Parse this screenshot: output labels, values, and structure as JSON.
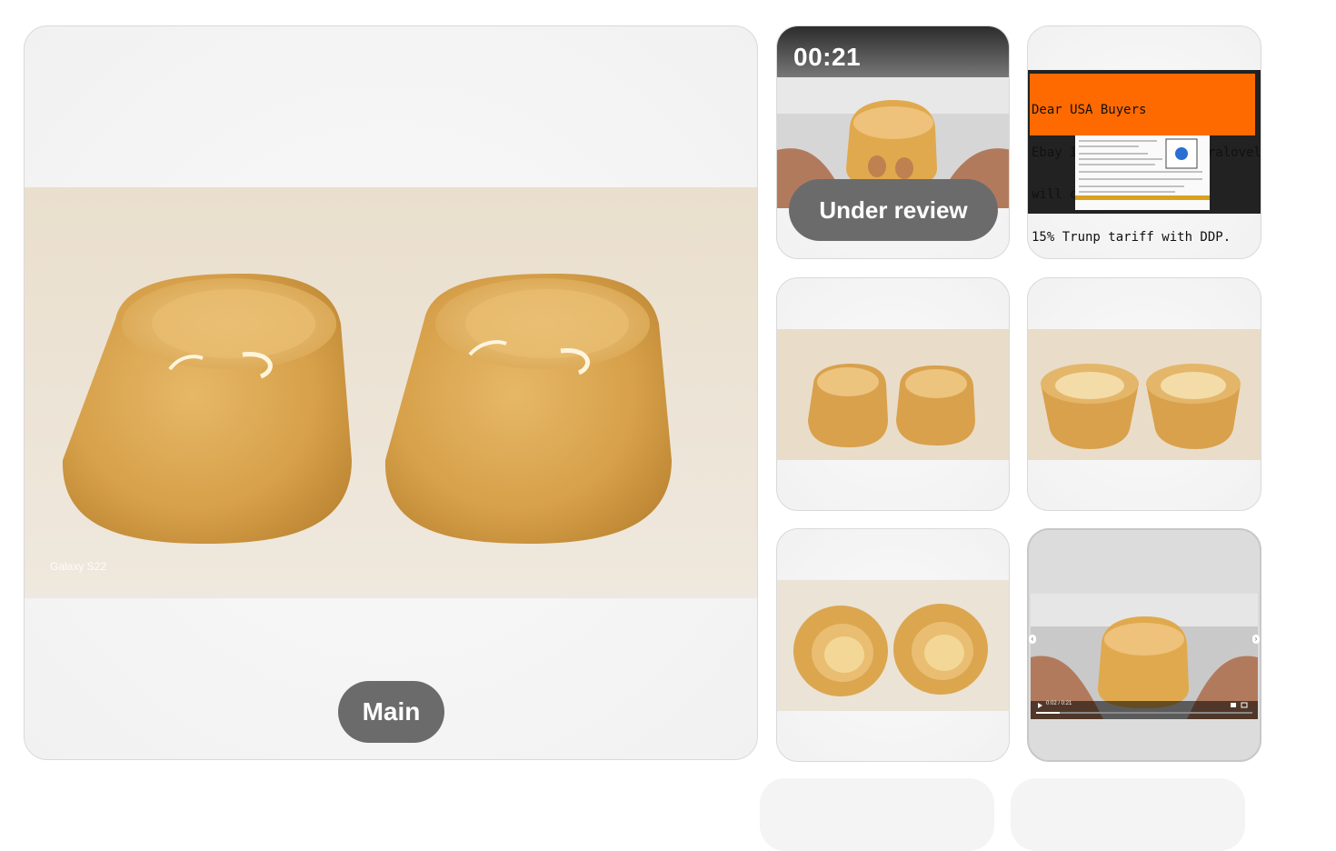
{
  "main_image": {
    "label": "Main",
    "watermark": "Galaxy S22"
  },
  "thumbnails": [
    {
      "type": "video",
      "duration": "00:21",
      "status": "Under review"
    },
    {
      "type": "notice",
      "lines": [
        "Dear USA Buyers",
        "Ebay ID microscope-cameralovelove",
        "will cover the full",
        "15% Trunp tariff with DDP."
      ]
    },
    {
      "type": "photo",
      "subject": "two-pucks-side"
    },
    {
      "type": "photo",
      "subject": "two-pucks-open"
    },
    {
      "type": "photo",
      "subject": "two-pucks-top"
    },
    {
      "type": "video-frame",
      "player_time": "0:02 / 0:21"
    }
  ],
  "colors": {
    "pill_bg": "#6b6b6b",
    "notice_orange": "#ff6a00",
    "product_amber": "#d9a24a"
  }
}
